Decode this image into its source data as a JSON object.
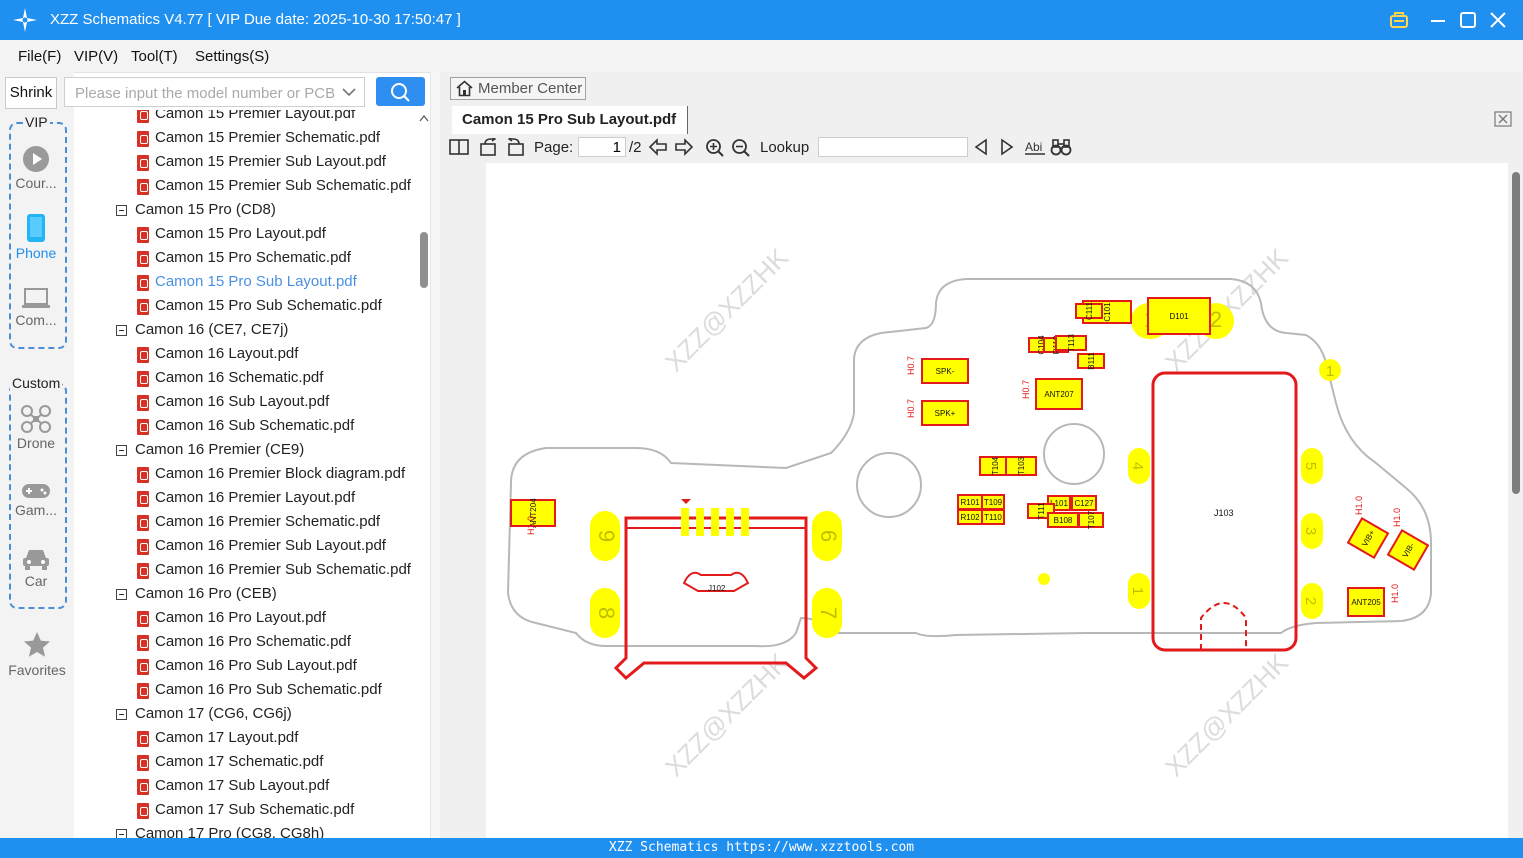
{
  "window": {
    "title": "XZZ Schematics V4.77 [ VIP Due date: 2025-10-30 17:50:47 ]",
    "accent": "#1f8ff0"
  },
  "menu": [
    "File(F)",
    "VIP(V)",
    "Tool(T)",
    "Settings(S)"
  ],
  "sidebar": {
    "shrink_label": "Shrink",
    "search_placeholder": "Please input the model number or PCB",
    "vip_label": "VIP",
    "custom_label": "Custom",
    "vip_items": [
      {
        "label": "Cour...",
        "icon": "play-icon"
      },
      {
        "label": "Phone",
        "icon": "phone-icon"
      },
      {
        "label": "Com...",
        "icon": "laptop-icon"
      }
    ],
    "custom_items": [
      {
        "label": "Drone",
        "icon": "drone-icon"
      },
      {
        "label": "Gam...",
        "icon": "gamepad-icon"
      },
      {
        "label": "Car",
        "icon": "car-icon"
      }
    ],
    "favorites_label": "Favorites"
  },
  "tree": [
    {
      "type": "file",
      "label": "Camon 15 Premier Layout.pdf"
    },
    {
      "type": "file",
      "label": "Camon 15 Premier Schematic.pdf"
    },
    {
      "type": "file",
      "label": "Camon 15 Premier Sub Layout.pdf"
    },
    {
      "type": "file",
      "label": "Camon 15 Premier Sub Schematic.pdf"
    },
    {
      "type": "folder",
      "label": "Camon 15 Pro (CD8)"
    },
    {
      "type": "file",
      "label": "Camon 15 Pro Layout.pdf"
    },
    {
      "type": "file",
      "label": "Camon 15 Pro Schematic.pdf"
    },
    {
      "type": "file",
      "label": "Camon 15 Pro Sub Layout.pdf",
      "selected": true
    },
    {
      "type": "file",
      "label": "Camon 15 Pro Sub Schematic.pdf"
    },
    {
      "type": "folder",
      "label": "Camon 16 (CE7, CE7j)"
    },
    {
      "type": "file",
      "label": "Camon 16 Layout.pdf"
    },
    {
      "type": "file",
      "label": "Camon 16 Schematic.pdf"
    },
    {
      "type": "file",
      "label": "Camon 16 Sub Layout.pdf"
    },
    {
      "type": "file",
      "label": "Camon 16 Sub Schematic.pdf"
    },
    {
      "type": "folder",
      "label": "Camon 16 Premier (CE9)"
    },
    {
      "type": "file",
      "label": "Camon 16 Premier Block diagram.pdf"
    },
    {
      "type": "file",
      "label": "Camon 16 Premier Layout.pdf"
    },
    {
      "type": "file",
      "label": "Camon 16 Premier Schematic.pdf"
    },
    {
      "type": "file",
      "label": "Camon 16 Premier Sub Layout.pdf"
    },
    {
      "type": "file",
      "label": "Camon 16 Premier Sub Schematic.pdf"
    },
    {
      "type": "folder",
      "label": "Camon 16 Pro (CEB)"
    },
    {
      "type": "file",
      "label": "Camon 16 Pro Layout.pdf"
    },
    {
      "type": "file",
      "label": "Camon 16 Pro Schematic.pdf"
    },
    {
      "type": "file",
      "label": "Camon 16 Pro Sub Layout.pdf"
    },
    {
      "type": "file",
      "label": "Camon 16 Pro Sub Schematic.pdf"
    },
    {
      "type": "folder",
      "label": "Camon 17 (CG6, CG6j)"
    },
    {
      "type": "file",
      "label": "Camon 17 Layout.pdf"
    },
    {
      "type": "file",
      "label": "Camon 17 Schematic.pdf"
    },
    {
      "type": "file",
      "label": "Camon 17 Sub Layout.pdf"
    },
    {
      "type": "file",
      "label": "Camon 17 Sub Schematic.pdf"
    },
    {
      "type": "folder",
      "label": "Camon 17 Pro (CG8, CG8h)"
    }
  ],
  "viewer": {
    "member_center_label": "Member Center",
    "tab_title": "Camon 15 Pro Sub Layout.pdf",
    "page_label": "Page:",
    "page_current": "1",
    "page_total": "/2",
    "lookup_label": "Lookup"
  },
  "board": {
    "watermark": "XZZ@XZZHK",
    "components": [
      "J103",
      "J102",
      "D101",
      "C101",
      "C111",
      "C104",
      "R110",
      "T113",
      "B111",
      "SPK-",
      "SPK+",
      "H0.7",
      "H0.7",
      "H0.7",
      "ANT207",
      "T104",
      "T103",
      "R101",
      "T109",
      "R102",
      "T110",
      "L101",
      "C127",
      "T111",
      "B108",
      "T107",
      "ANT204",
      "H1.0",
      "ANT205",
      "H1.0",
      "VIB+",
      "H1.0",
      "VIB-",
      "H1.0"
    ],
    "pads": [
      "1",
      "2",
      "1",
      "4",
      "5",
      "3",
      "1",
      "2",
      "9",
      "6",
      "8",
      "7"
    ]
  },
  "footer": "XZZ Schematics https://www.xzztools.com"
}
